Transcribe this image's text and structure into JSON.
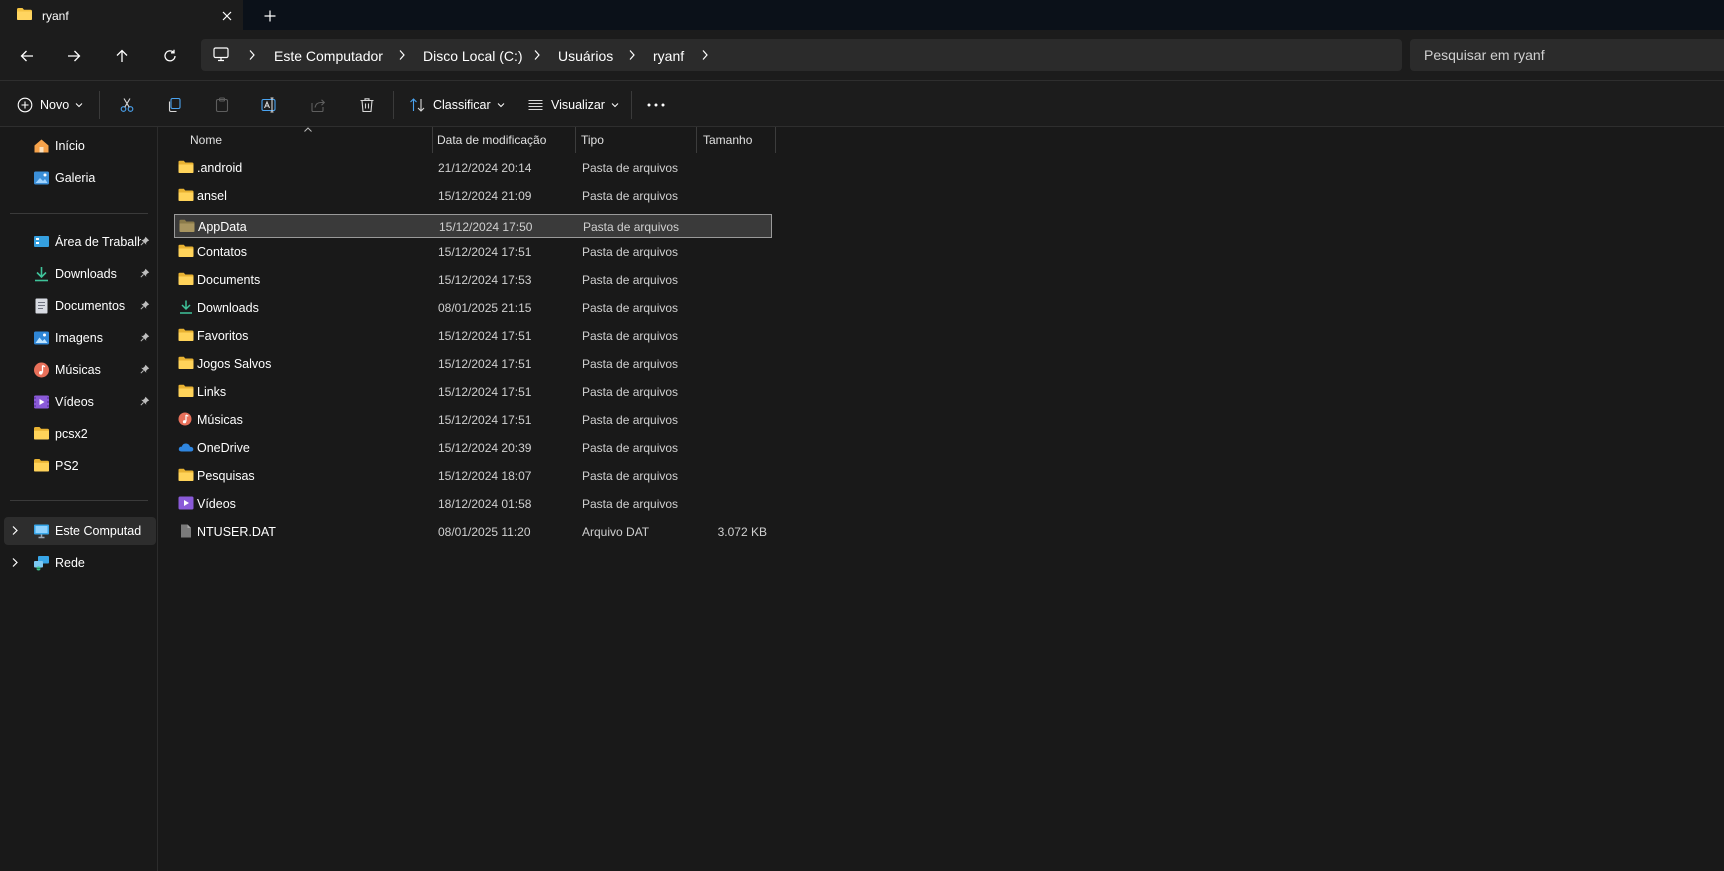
{
  "window": {
    "tab_title": "ryanf",
    "tab_icon": "folder-icon",
    "close_icon": "close-icon",
    "new_tab_icon": "plus-icon"
  },
  "navigation": {
    "back_icon": "arrow-left-icon",
    "forward_icon": "arrow-right-icon",
    "up_icon": "arrow-up-icon",
    "refresh_icon": "refresh-icon"
  },
  "breadcrumb": {
    "root_icon": "monitor-icon",
    "items": [
      "Este Computador",
      "Disco Local (C:)",
      "Usuários",
      "ryanf"
    ]
  },
  "search": {
    "placeholder": "Pesquisar em ryanf"
  },
  "toolbar": {
    "new_label": "Novo",
    "sort_label": "Classificar",
    "view_label": "Visualizar",
    "icons": [
      "cut-icon",
      "copy-icon",
      "paste-icon",
      "rename-icon",
      "share-icon",
      "delete-icon",
      "more-icon"
    ]
  },
  "sidebar": {
    "top_items": [
      {
        "label": "Início",
        "icon": "home-icon"
      },
      {
        "label": "Galeria",
        "icon": "gallery-icon"
      }
    ],
    "quick_access": [
      {
        "label": "Área de Trabalho",
        "icon": "desktop-icon",
        "pinned": true
      },
      {
        "label": "Downloads",
        "icon": "download-icon",
        "pinned": true
      },
      {
        "label": "Documentos",
        "icon": "document-icon",
        "pinned": true
      },
      {
        "label": "Imagens",
        "icon": "image-icon",
        "pinned": true
      },
      {
        "label": "Músicas",
        "icon": "music-icon",
        "pinned": true
      },
      {
        "label": "Vídeos",
        "icon": "video-icon",
        "pinned": true
      },
      {
        "label": "pcsx2",
        "icon": "folder-icon",
        "pinned": false
      },
      {
        "label": "PS2",
        "icon": "folder-icon",
        "pinned": false
      }
    ],
    "locations": [
      {
        "label": "Este Computador",
        "icon": "computer-icon",
        "selected": true
      },
      {
        "label": "Rede",
        "icon": "network-icon",
        "selected": false
      }
    ]
  },
  "table": {
    "columns": [
      "Nome",
      "Data de modificação",
      "Tipo",
      "Tamanho"
    ],
    "rows": [
      {
        "name": ".android",
        "date": "21/12/2024 20:14",
        "type": "Pasta de arquivos",
        "size": "",
        "icon": "folder-icon"
      },
      {
        "name": "ansel",
        "date": "15/12/2024 21:09",
        "type": "Pasta de arquivos",
        "size": "",
        "icon": "folder-icon"
      },
      {
        "name": "AppData",
        "date": "15/12/2024 17:50",
        "type": "Pasta de arquivos",
        "size": "",
        "icon": "folder-hidden-icon",
        "selected": true
      },
      {
        "name": "Contatos",
        "date": "15/12/2024 17:51",
        "type": "Pasta de arquivos",
        "size": "",
        "icon": "folder-icon"
      },
      {
        "name": "Documents",
        "date": "15/12/2024 17:53",
        "type": "Pasta de arquivos",
        "size": "",
        "icon": "folder-icon"
      },
      {
        "name": "Downloads",
        "date": "08/01/2025 21:15",
        "type": "Pasta de arquivos",
        "size": "",
        "icon": "download-icon"
      },
      {
        "name": "Favoritos",
        "date": "15/12/2024 17:51",
        "type": "Pasta de arquivos",
        "size": "",
        "icon": "folder-icon"
      },
      {
        "name": "Jogos Salvos",
        "date": "15/12/2024 17:51",
        "type": "Pasta de arquivos",
        "size": "",
        "icon": "folder-icon"
      },
      {
        "name": "Links",
        "date": "15/12/2024 17:51",
        "type": "Pasta de arquivos",
        "size": "",
        "icon": "folder-icon"
      },
      {
        "name": "Músicas",
        "date": "15/12/2024 17:51",
        "type": "Pasta de arquivos",
        "size": "",
        "icon": "music-icon"
      },
      {
        "name": "OneDrive",
        "date": "15/12/2024 20:39",
        "type": "Pasta de arquivos",
        "size": "",
        "icon": "cloud-icon"
      },
      {
        "name": "Pesquisas",
        "date": "15/12/2024 18:07",
        "type": "Pasta de arquivos",
        "size": "",
        "icon": "folder-icon"
      },
      {
        "name": "Vídeos",
        "date": "18/12/2024 01:58",
        "type": "Pasta de arquivos",
        "size": "",
        "icon": "video-icon"
      },
      {
        "name": "NTUSER.DAT",
        "date": "08/01/2025 11:20",
        "type": "Arquivo DAT",
        "size": "3.072 KB",
        "icon": "file-icon"
      }
    ]
  },
  "colors": {
    "folder": "#f5c342",
    "accent_blue": "#4aa3f0",
    "background": "#191919",
    "chrome": "#1c1c1c"
  }
}
